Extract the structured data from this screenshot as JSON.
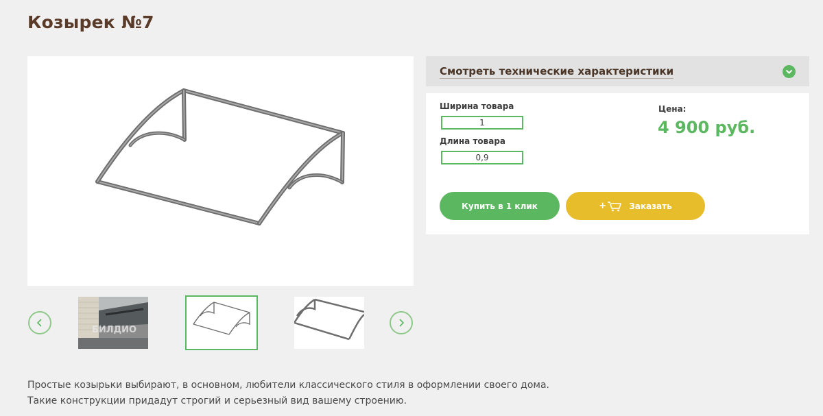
{
  "product": {
    "title": "Козырек №7"
  },
  "gallery": {
    "thumbnails": [
      {
        "name": "photo-installed",
        "watermark": "БИЛДИО"
      },
      {
        "name": "frame-drawing-1"
      },
      {
        "name": "frame-drawing-2"
      }
    ],
    "selected_index": 1,
    "prev_icon": "chevron-left-icon",
    "next_icon": "chevron-right-icon"
  },
  "specs": {
    "label": "Смотреть технические характеристики",
    "toggle_icon": "chevron-down-icon"
  },
  "order": {
    "width_label": "Ширина товара",
    "width_value": "1",
    "length_label": "Длина товара",
    "length_value": "0,9",
    "price_label": "Цена:",
    "price_value": "4 900 руб.",
    "buy_one_click_label": "Купить в 1 клик",
    "order_label": "Заказать",
    "order_prefix": "+",
    "cart_icon": "cart-icon"
  },
  "description": {
    "line1": "Простые козырьки выбирают, в основном, любители классического стиля в оформлении своего дома.",
    "line2": "Такие конструкции придадут строгий и серьезный вид вашему строению."
  },
  "colors": {
    "accent_green": "#5cb860",
    "accent_yellow": "#e8bd2c",
    "title_brown": "#5a3a28",
    "background": "#f0f0f0"
  }
}
